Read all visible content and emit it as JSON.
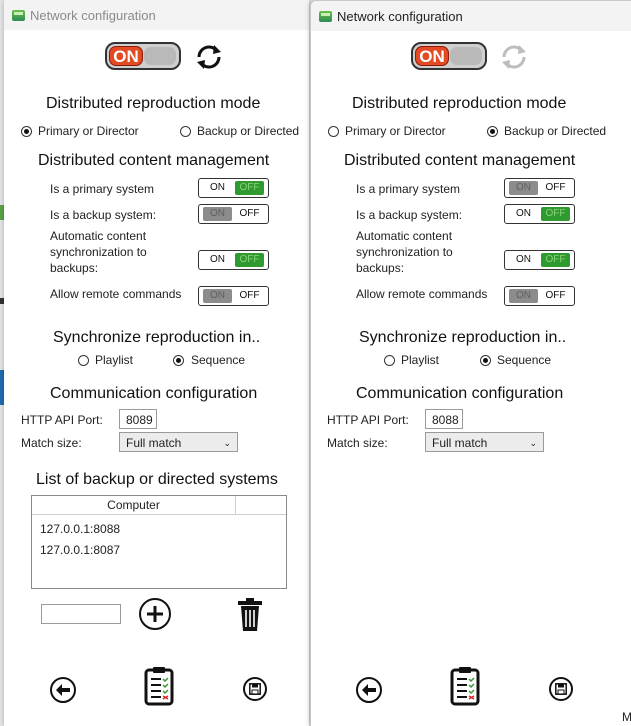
{
  "windows": [
    {
      "title": "Network configuration",
      "master_toggle": "ON",
      "mode_heading": "Distributed reproduction mode",
      "mode_options": [
        "Primary or Director",
        "Backup or Directed"
      ],
      "mode_selected": "Primary or Director",
      "content_heading": "Distributed content management",
      "settings": {
        "primary": "Is a primary system",
        "backup": "Is a backup system:",
        "sync_line1": "Automatic content",
        "sync_line2": "synchronization to",
        "sync_line3": "backups:",
        "remote": "Allow remote commands"
      },
      "toggle_on_label": "ON",
      "toggle_off_label": "OFF",
      "toggle_states": {
        "primary": "on",
        "backup": "off",
        "sync": "on",
        "remote": "off"
      },
      "sync_heading": "Synchronize reproduction in..",
      "sync_options": [
        "Playlist",
        "Sequence"
      ],
      "sync_selected": "Sequence",
      "comm_heading": "Communication configuration",
      "http_label": "HTTP API Port:",
      "http_value": "8089",
      "match_label": "Match size:",
      "match_value": "Full match",
      "list_heading": "List of backup or directed systems",
      "list_column": "Computer",
      "list_rows": [
        "127.0.0.1:8088",
        "127.0.0.1:8087"
      ],
      "add_input_value": ""
    },
    {
      "title": "Network configuration",
      "master_toggle": "ON",
      "mode_heading": "Distributed reproduction mode",
      "mode_options": [
        "Primary or Director",
        "Backup or Directed"
      ],
      "mode_selected": "Backup or Directed",
      "content_heading": "Distributed content management",
      "settings": {
        "primary": "Is a primary system",
        "backup": "Is a backup system:",
        "sync_line1": "Automatic content",
        "sync_line2": "synchronization to",
        "sync_line3": "backups:",
        "remote": "Allow remote commands"
      },
      "toggle_on_label": "ON",
      "toggle_off_label": "OFF",
      "toggle_states": {
        "primary": "off",
        "backup": "on",
        "sync": "on",
        "remote": "off"
      },
      "sync_heading": "Synchronize reproduction in..",
      "sync_options": [
        "Playlist",
        "Sequence"
      ],
      "sync_selected": "Sequence",
      "comm_heading": "Communication configuration",
      "http_label": "HTTP API Port:",
      "http_value": "8088",
      "match_label": "Match size:",
      "match_value": "Full match"
    }
  ],
  "desktop_edge_text": "M",
  "colors": {
    "on_red": "#e14a22",
    "toggle_green": "#2f9a2f",
    "toggle_grey": "#8c8c8c"
  },
  "icons": [
    "refresh-icon",
    "add-icon",
    "trash-icon",
    "back-icon",
    "clipboard-checklist-icon",
    "save-icon"
  ]
}
